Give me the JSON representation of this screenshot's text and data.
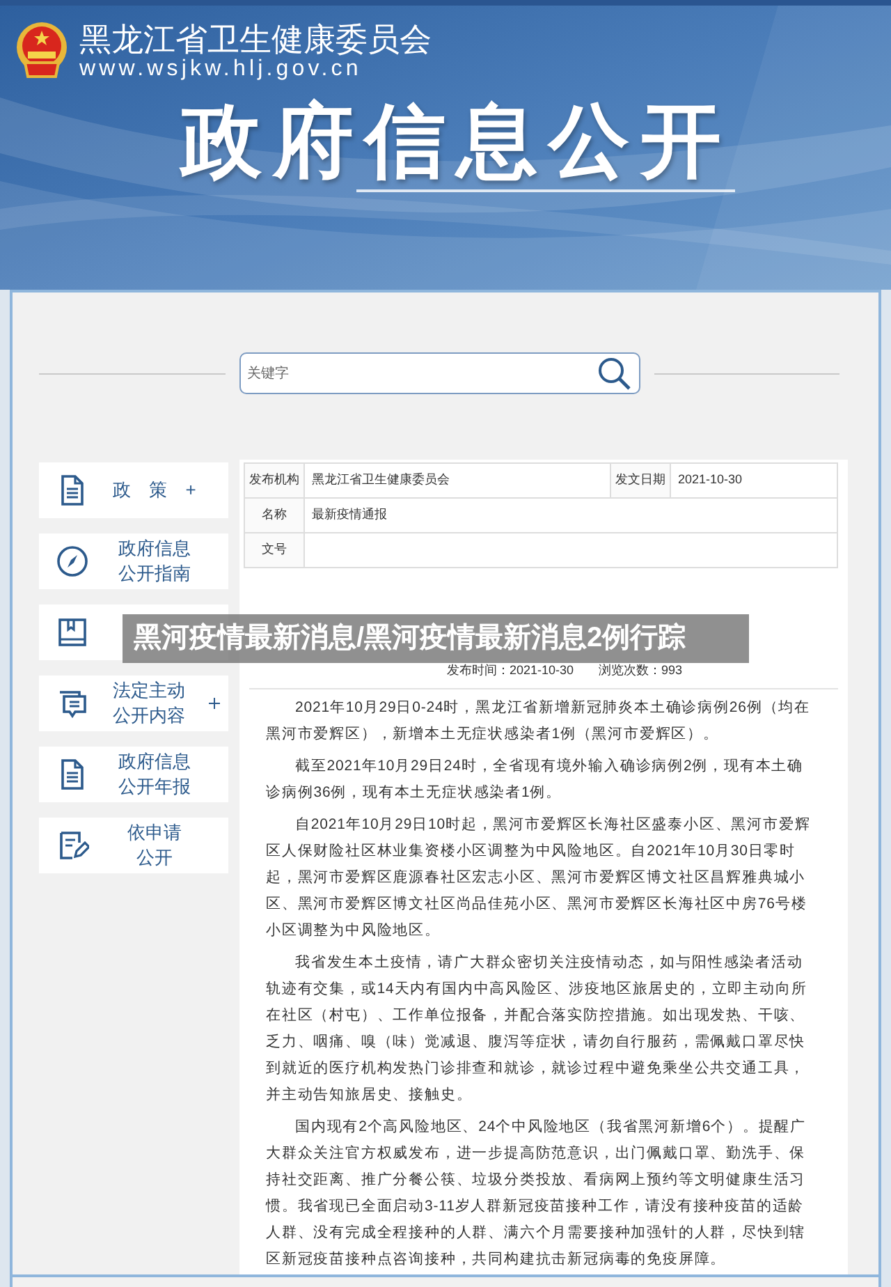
{
  "header": {
    "org_name": "黑龙江省卫生健康委员会",
    "url": "www.wsjkw.hlj.gov.cn",
    "banner_title": "政府信息公开"
  },
  "search": {
    "placeholder": "关键字"
  },
  "sidebar": {
    "items": [
      {
        "lines": [
          "政　策　+"
        ],
        "plus": false
      },
      {
        "lines": [
          "政府信息",
          "公开指南"
        ],
        "plus": false
      },
      {
        "plus": false
      },
      {
        "lines": [
          "法定主动",
          "公开内容"
        ],
        "plus": true
      },
      {
        "lines": [
          "政府信息",
          "公开年报"
        ],
        "plus": false
      },
      {
        "lines": [
          "依申请",
          "公开"
        ],
        "plus": false
      }
    ]
  },
  "info_table": {
    "rows": [
      {
        "label": "发布机构",
        "value": "黑龙江省卫生健康委员会",
        "label_2": "发文日期",
        "value_2": "2021-10-30"
      },
      {
        "label": "名称",
        "value": "最新疫情通报"
      },
      {
        "label": "文号"
      }
    ]
  },
  "document": {
    "meta": "发布时间：2021-10-30　　浏览次数：993",
    "paragraphs": [
      "2021年10月29日0-24时，黑龙江省新增新冠肺炎本土确诊病例26例（均在黑河市爱辉区），新增本土无症状感染者1例（黑河市爱辉区）。",
      "截至2021年10月29日24时，全省现有境外输入确诊病例2例，现有本土确诊病例36例，现有本土无症状感染者1例。",
      "自2021年10月29日10时起，黑河市爱辉区长海社区盛泰小区、黑河市爱辉区人保财险社区林业集资楼小区调整为中风险地区。自2021年10月30日零时起，黑河市爱辉区鹿源春社区宏志小区、黑河市爱辉区博文社区昌辉雅典城小区、黑河市爱辉区博文社区尚品佳苑小区、黑河市爱辉区长海社区中房76号楼小区调整为中风险地区。",
      "我省发生本土疫情，请广大群众密切关注疫情动态，如与阳性感染者活动轨迹有交集，或14天内有国内中高风险区、涉疫地区旅居史的，立即主动向所在社区（村屯）、工作单位报备，并配合落实防控措施。如出现发热、干咳、乏力、咽痛、嗅（味）觉减退、腹泻等症状，请勿自行服药，需佩戴口罩尽快到就近的医疗机构发热门诊排查和就诊，就诊过程中避免乘坐公共交通工具，并主动告知旅居史、接触史。",
      "国内现有2个高风险地区、24个中风险地区（我省黑河新增6个）。提醒广大群众关注官方权威发布，进一步提高防范意识，出门佩戴口罩、勤洗手、保持社交距离、推广分餐公筷、垃圾分类投放、看病网上预约等文明健康生活习惯。我省现已全面启动3-11岁人群新冠疫苗接种工作，请没有接种疫苗的适龄人群、没有完成全程接种的人群、满六个月需要接种加强针的人群，尽快到辖区新冠疫苗接种点咨询接种，共同构建抗击新冠病毒的免疫屏障。"
    ]
  },
  "overlay_caption": "黑河疫情最新消息/黑河疫情最新消息2例行踪"
}
